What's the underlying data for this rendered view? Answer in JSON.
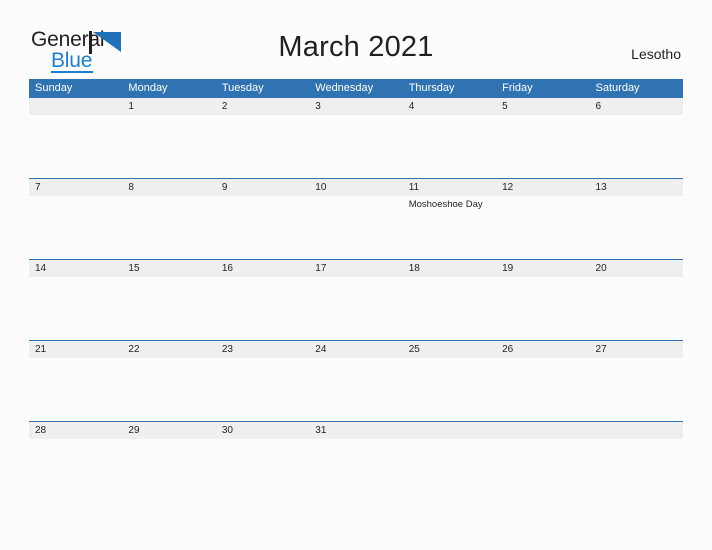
{
  "brand": {
    "name_top": "General",
    "name_bottom": "Blue",
    "mark": "triangle-logo-icon",
    "accent_color": "#1f72b8",
    "text_color": "#231f20"
  },
  "header": {
    "title": "March 2021",
    "locale": "Lesotho"
  },
  "colors": {
    "weekday_header_bg": "#2f73b3",
    "date_band_bg": "#efefef",
    "page_bg": "#fcfcfc",
    "rule": "#2f73b3"
  },
  "calendar": {
    "month": "March",
    "year": "2021",
    "weekday_headers": [
      "Sunday",
      "Monday",
      "Tuesday",
      "Wednesday",
      "Thursday",
      "Friday",
      "Saturday"
    ],
    "weeks": [
      {
        "days": [
          {
            "date": "",
            "events": []
          },
          {
            "date": "1",
            "events": []
          },
          {
            "date": "2",
            "events": []
          },
          {
            "date": "3",
            "events": []
          },
          {
            "date": "4",
            "events": []
          },
          {
            "date": "5",
            "events": []
          },
          {
            "date": "6",
            "events": []
          }
        ]
      },
      {
        "days": [
          {
            "date": "7",
            "events": []
          },
          {
            "date": "8",
            "events": []
          },
          {
            "date": "9",
            "events": []
          },
          {
            "date": "10",
            "events": []
          },
          {
            "date": "11",
            "events": [
              "Moshoeshoe Day"
            ]
          },
          {
            "date": "12",
            "events": []
          },
          {
            "date": "13",
            "events": []
          }
        ]
      },
      {
        "days": [
          {
            "date": "14",
            "events": []
          },
          {
            "date": "15",
            "events": []
          },
          {
            "date": "16",
            "events": []
          },
          {
            "date": "17",
            "events": []
          },
          {
            "date": "18",
            "events": []
          },
          {
            "date": "19",
            "events": []
          },
          {
            "date": "20",
            "events": []
          }
        ]
      },
      {
        "days": [
          {
            "date": "21",
            "events": []
          },
          {
            "date": "22",
            "events": []
          },
          {
            "date": "23",
            "events": []
          },
          {
            "date": "24",
            "events": []
          },
          {
            "date": "25",
            "events": []
          },
          {
            "date": "26",
            "events": []
          },
          {
            "date": "27",
            "events": []
          }
        ]
      },
      {
        "days": [
          {
            "date": "28",
            "events": []
          },
          {
            "date": "29",
            "events": []
          },
          {
            "date": "30",
            "events": []
          },
          {
            "date": "31",
            "events": []
          },
          {
            "date": "",
            "events": []
          },
          {
            "date": "",
            "events": []
          },
          {
            "date": "",
            "events": []
          }
        ]
      }
    ]
  }
}
